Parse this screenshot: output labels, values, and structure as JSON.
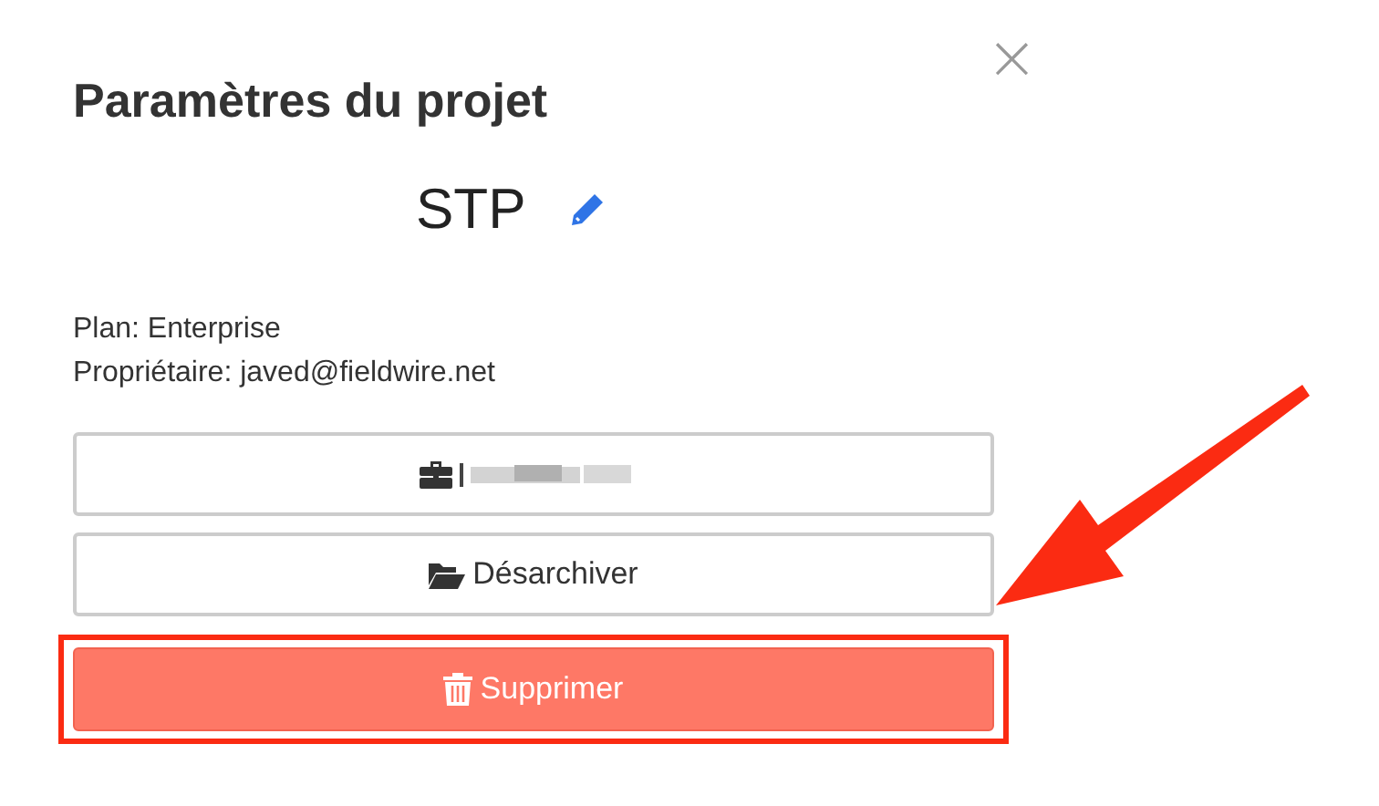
{
  "dialog": {
    "title": "Paramètres du projet",
    "close": "×",
    "project_name": "STP",
    "info": [
      "Plan: Enterprise",
      "Propriétaire: javed@fieldwire.net"
    ]
  },
  "buttons": [
    {
      "kind": "redacted"
    },
    {
      "kind": "normal",
      "label": "Désarchiver"
    },
    {
      "kind": "danger",
      "label": "Supprimer"
    }
  ],
  "annotations": {
    "highlight_box": true,
    "arrow": true
  }
}
